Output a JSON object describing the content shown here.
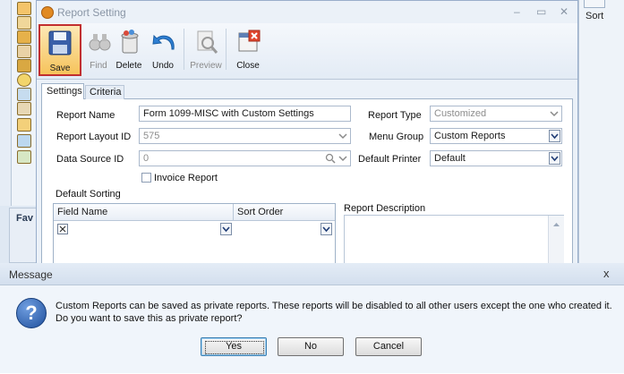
{
  "background": {
    "favorites_label": "Fav",
    "sort_label": "Sort"
  },
  "window": {
    "title": "Report Setting",
    "controls": {
      "minimize": "‒",
      "maximize": "▭",
      "close": "✕"
    }
  },
  "toolbar": {
    "save": "Save",
    "find": "Find",
    "delete": "Delete",
    "undo": "Undo",
    "preview": "Preview",
    "close": "Close"
  },
  "tabs": {
    "settings": "Settings",
    "criteria": "Criteria"
  },
  "form": {
    "report_name_label": "Report Name",
    "report_name_value": "Form 1099-MISC with Custom Settings",
    "report_layout_id_label": "Report Layout ID",
    "report_layout_id_value": "575",
    "data_source_id_label": "Data Source ID",
    "data_source_id_value": "0",
    "report_type_label": "Report Type",
    "report_type_value": "Customized",
    "menu_group_label": "Menu Group",
    "menu_group_value": "Custom Reports",
    "default_printer_label": "Default Printer",
    "default_printer_value": "Default",
    "invoice_report_label": "Invoice Report",
    "default_sorting_label": "Default Sorting",
    "report_description_label": "Report Description",
    "grid": {
      "columns": [
        "Field Name",
        "Sort Order"
      ]
    }
  },
  "dialog": {
    "title": "Message",
    "close": "x",
    "line1": "Custom Reports can be saved as private reports. These reports will be disabled to all other users except the one who created it.",
    "line2": "Do you want to save this as private report?",
    "yes": "Yes",
    "no": "No",
    "cancel": "Cancel"
  }
}
